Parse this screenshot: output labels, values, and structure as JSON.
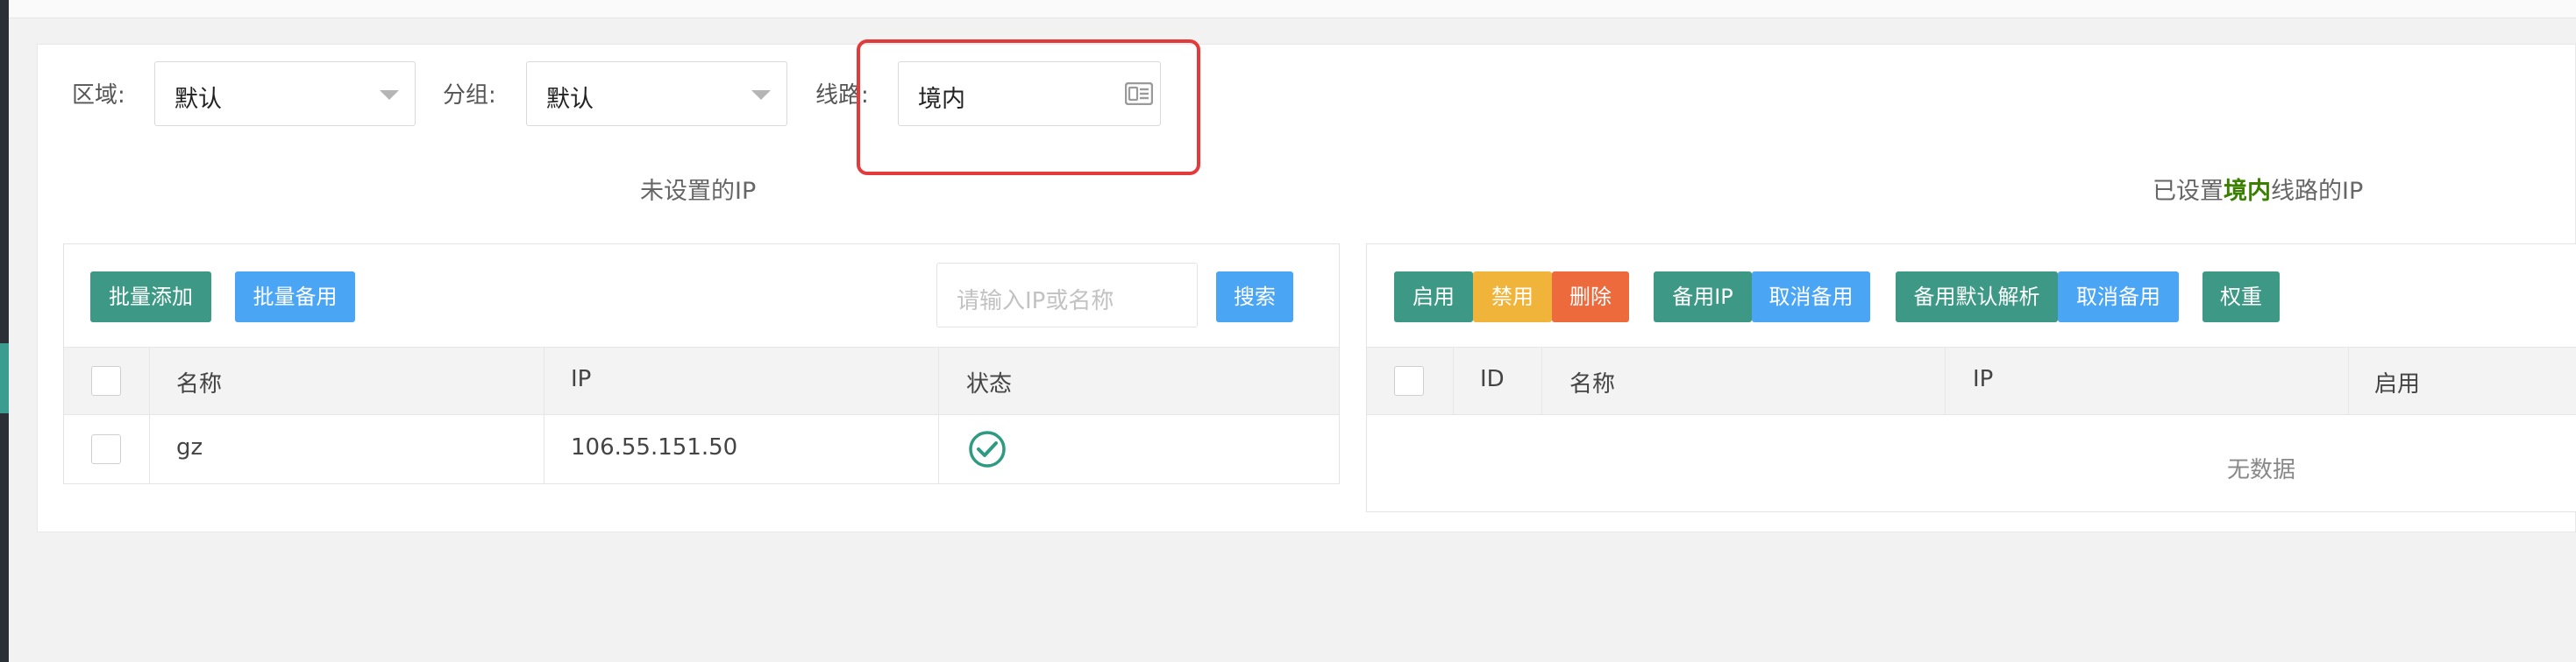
{
  "filters": {
    "region": {
      "label": "区域:",
      "value": "默认"
    },
    "group": {
      "label": "分组:",
      "value": "默认"
    },
    "line": {
      "label": "线路:",
      "value": "境内"
    }
  },
  "left": {
    "title": "未设置的IP",
    "buttons": {
      "batch_add": "批量添加",
      "batch_backup": "批量备用",
      "search": "搜索"
    },
    "search_placeholder": "请输入IP或名称",
    "columns": {
      "name": "名称",
      "ip": "IP",
      "status": "状态"
    },
    "rows": [
      {
        "name": "gz",
        "ip": "106.55.151.50",
        "status": "enabled"
      }
    ]
  },
  "right": {
    "title_prefix": "已设置",
    "title_em": "境内",
    "title_suffix": "线路的IP",
    "buttons": {
      "enable": "启用",
      "disable": "禁用",
      "delete": "删除",
      "backup_ip": "备用IP",
      "cancel_backup": "取消备用",
      "backup_default": "备用默认解析",
      "cancel_backup2": "取消备用",
      "weight": "权重"
    },
    "columns": {
      "id": "ID",
      "name": "名称",
      "ip": "IP",
      "enabled": "启用"
    },
    "empty_text": "无数据"
  },
  "colors": {
    "teal": "#3d9985",
    "blue": "#4ba5f5",
    "yellow": "#f0b43b",
    "orange": "#ec6a3c",
    "highlight": "#e33b3b",
    "check": "#2f9a82"
  }
}
